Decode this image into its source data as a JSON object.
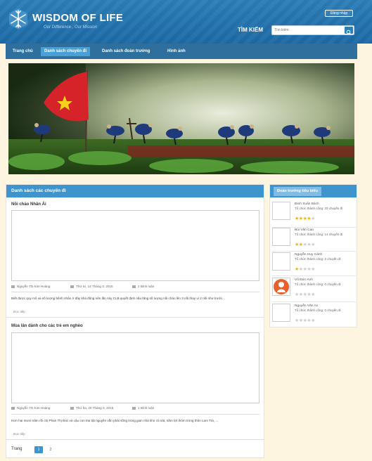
{
  "header": {
    "brand": "WISDOM OF LIFE",
    "tagline": "Our Difference , Our Mission",
    "login_label": "Đăng nhập",
    "search_label": "TÌM KIẾM",
    "search_placeholder": "Tìm kiếm"
  },
  "nav": {
    "items": [
      {
        "label": "Trang chủ",
        "active": false
      },
      {
        "label": "Danh sách chuyến đi",
        "active": true
      },
      {
        "label": "Danh sách đoàn trưởng",
        "active": false
      },
      {
        "label": "Hình ảnh",
        "active": false
      }
    ]
  },
  "trips_panel": {
    "title": "Danh sách các chuyến đi",
    "trips": [
      {
        "title": "Nồi cháo Nhân Ái",
        "author": "Nguyễn Thị Kim Hoàng",
        "date": "Thứ tư, 14 Tháng 3, 2015",
        "comments": "2 Bình luận",
        "description": "Biết được quy mô và số lượng bệnh nhân ở đây khá đông nên lần này CLB quyết định nấu tăng số lượng nồi cháo lên 3 nồi thay vì 2 nồi như trước...",
        "readmore": "Đọc tiếp"
      },
      {
        "title": "Mùa lân dành cho các trẻ em nghèo",
        "author": "Nguyễn Thị Kim Hoàng",
        "date": "Thứ ba, 20 Tháng 3, 2015",
        "comments": "1 Bình luận",
        "description": "Hơn hai mươi năm rồi chị Phan Thị Đúc và cậu con trai tật nguyền vẫn phải sống trong gian nhà kho cũ nát, nằm lợt thỏm trong thôn Lam Trà, ...",
        "readmore": "Đọc tiếp"
      }
    ],
    "pager": {
      "label": "Trang",
      "pages": [
        "1",
        "2"
      ],
      "current": "1"
    }
  },
  "sidebar": {
    "title": "Đoàn trưởng tiêu biểu",
    "leaders": [
      {
        "name": "Đinh Xuân Bách",
        "stat": "Tổ chức thành công: 33 chuyến đi",
        "rating": 4
      },
      {
        "name": "Bùi Văn Cao",
        "stat": "Tổ chức thành công: 14 chuyến đi",
        "rating": 2
      },
      {
        "name": "Nguyễn Huy Cảnh",
        "stat": "Tổ chức thành công: 2 chuyến đi",
        "rating": 1
      },
      {
        "name": "Võ Đức Anh",
        "stat": "Tổ chức thành công: 0 chuyến đi",
        "rating": 0
      },
      {
        "name": "Nguyễn Văn An",
        "stat": "Tổ chức thành công: 0 chuyến đi",
        "rating": 0
      }
    ]
  },
  "colors": {
    "header": "#1d6aa6",
    "accent": "#3e94cd",
    "nav": "#2e6f9e",
    "star": "#e8b21a",
    "background": "#fdf5e0"
  }
}
